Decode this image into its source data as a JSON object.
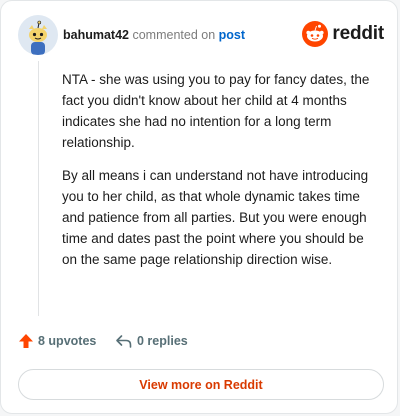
{
  "header": {
    "username": "bahumat42",
    "action_text": "commented on",
    "post_link": "post",
    "brand": "reddit",
    "brand_color": "#ff4500"
  },
  "comment": {
    "paragraphs": [
      "NTA - she was using you to pay for fancy dates, the fact you didn't know about her child at 4 months indicates she had no intention for a long term relationship.",
      "By all means i can understand not have introducing you to her child, as that whole dynamic takes time and patience from all parties. But you were enough time and dates past the point where you should be on the same page relationship direction wise."
    ]
  },
  "actions": {
    "upvotes": "8 upvotes",
    "upvote_icon": "upvote-arrow-icon",
    "upvote_color": "#ff4500",
    "replies": "0 replies",
    "reply_icon": "reply-arrow-icon"
  },
  "footer": {
    "view_more": "View more on Reddit",
    "view_more_color": "#d93a00"
  }
}
